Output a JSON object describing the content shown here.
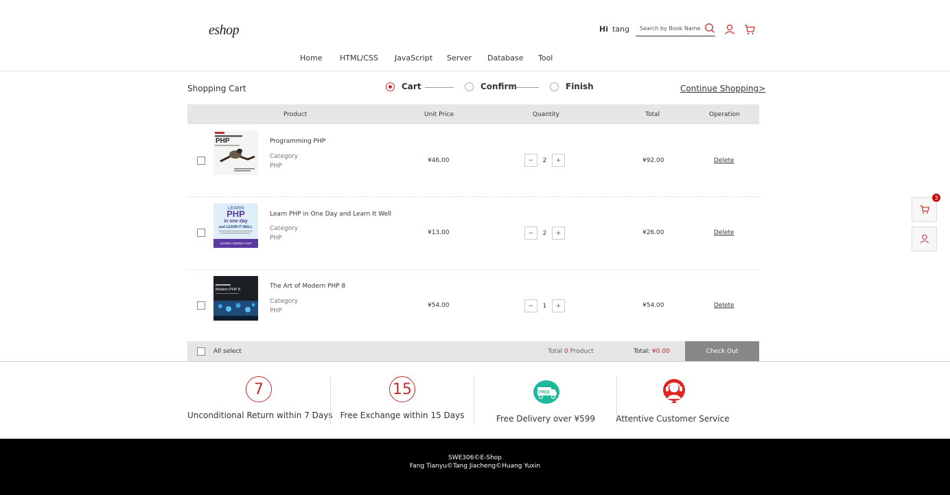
{
  "header": {
    "logo": "eshop",
    "greeting": "Hi",
    "username": "tang",
    "search_placeholder": "Search by Book Name"
  },
  "nav": [
    "Home",
    "HTML/CSS",
    "JavaScript",
    "Server",
    "Database",
    "Tool"
  ],
  "cart": {
    "title": "Shopping Cart",
    "steps": [
      "Cart",
      "Confirm",
      "Finish"
    ],
    "active_step": "Cart",
    "continue_label": "Continue Shopping>",
    "columns": [
      "Product",
      "Unit Price",
      "Quantity",
      "Total",
      "Operation"
    ],
    "items": [
      {
        "name": "Programming PHP",
        "category_label": "Category",
        "category": "PHP",
        "price": "¥46.00",
        "qty": "2",
        "total": "¥92.00",
        "action": "Delete",
        "cover": "programming-php-cover"
      },
      {
        "name": "Learn PHP in One Day and Learn It Well",
        "category_label": "Category",
        "category": "PHP",
        "price": "¥13.00",
        "qty": "2",
        "total": "¥26.00",
        "action": "Delete",
        "cover": "learn-php-cover"
      },
      {
        "name": "The Art of Modern PHP 8",
        "category_label": "Category",
        "category": "PHP",
        "price": "¥54.00",
        "qty": "1",
        "total": "¥54.00",
        "action": "Delete",
        "cover": "modern-php-cover"
      }
    ],
    "qty_minus": "−",
    "qty_plus": "+",
    "footer": {
      "all_select": "All select",
      "total_prefix": "Total",
      "total_count": "0",
      "total_suffix": "Product",
      "total_label": "Total:",
      "total_amount": "¥0.00",
      "checkout": "Check Out"
    }
  },
  "services": [
    {
      "icon": "7",
      "label": "Unconditional Return within 7 Days"
    },
    {
      "icon": "15",
      "label": "Free Exchange within 15 Days"
    },
    {
      "icon": "free-delivery-icon",
      "label": "Free Delivery over ¥599"
    },
    {
      "icon": "customer-service-icon",
      "label": "Attentive Customer Service"
    }
  ],
  "footer": {
    "line1": "SWE306©E-Shop",
    "line2": "Fang Tianyu©Tang Jiacheng©Huang Yuxin"
  },
  "side": {
    "cart_badge": "3"
  },
  "colors": {
    "accent": "#c42b2b",
    "header_gray": "#e6e6e6",
    "checkout_gray": "#888888",
    "footer_bg": "#000000"
  }
}
